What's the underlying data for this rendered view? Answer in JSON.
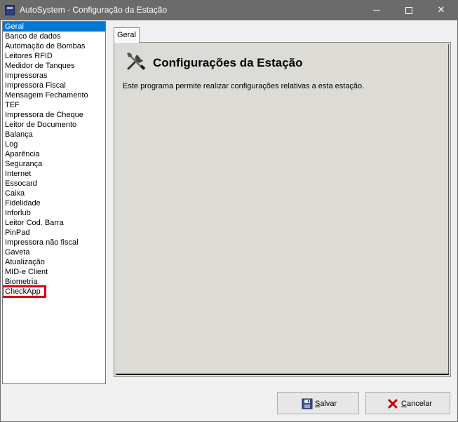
{
  "window": {
    "title": "AutoSystem - Configuração da Estação",
    "controls": {
      "minimize": "minimize-icon",
      "maximize": "maximize-icon",
      "close": "✕"
    }
  },
  "sidebar": {
    "items": [
      {
        "label": "Geral",
        "state": "selected"
      },
      {
        "label": "Banco de dados"
      },
      {
        "label": "Automação de Bombas"
      },
      {
        "label": "Leitores RFID"
      },
      {
        "label": "Medidor de Tanques"
      },
      {
        "label": "Impressoras"
      },
      {
        "label": "Impressora Fiscal"
      },
      {
        "label": "Mensagem Fechamento"
      },
      {
        "label": "TEF"
      },
      {
        "label": "Impressora de Cheque"
      },
      {
        "label": "Leitor de Documento"
      },
      {
        "label": "Balança"
      },
      {
        "label": "Log"
      },
      {
        "label": "Aparência"
      },
      {
        "label": "Segurança"
      },
      {
        "label": "Internet"
      },
      {
        "label": "Essocard"
      },
      {
        "label": "Caixa"
      },
      {
        "label": "Fidelidade"
      },
      {
        "label": "Inforlub"
      },
      {
        "label": "Leitor Cod. Barra"
      },
      {
        "label": "PinPad"
      },
      {
        "label": "Impressora não fiscal"
      },
      {
        "label": "Gaveta"
      },
      {
        "label": "Atualização"
      },
      {
        "label": "MID-e Client"
      },
      {
        "label": "Biometria"
      },
      {
        "label": "CheckApp",
        "state": "highlighted"
      }
    ],
    "selected_color": "#0078d7",
    "highlight_color": "#d9000f"
  },
  "main": {
    "tab_label": "Geral",
    "icon": "tools-icon",
    "title": "Configurações da Estação",
    "description": "Este programa permite realizar configurações relativas a esta estação."
  },
  "footer": {
    "save_label": "Salvar",
    "save_underline_index": 0,
    "save_icon": "floppy-disk-icon",
    "cancel_label": "Cancelar",
    "cancel_underline_index": 0,
    "cancel_icon": "cancel-x-icon"
  }
}
